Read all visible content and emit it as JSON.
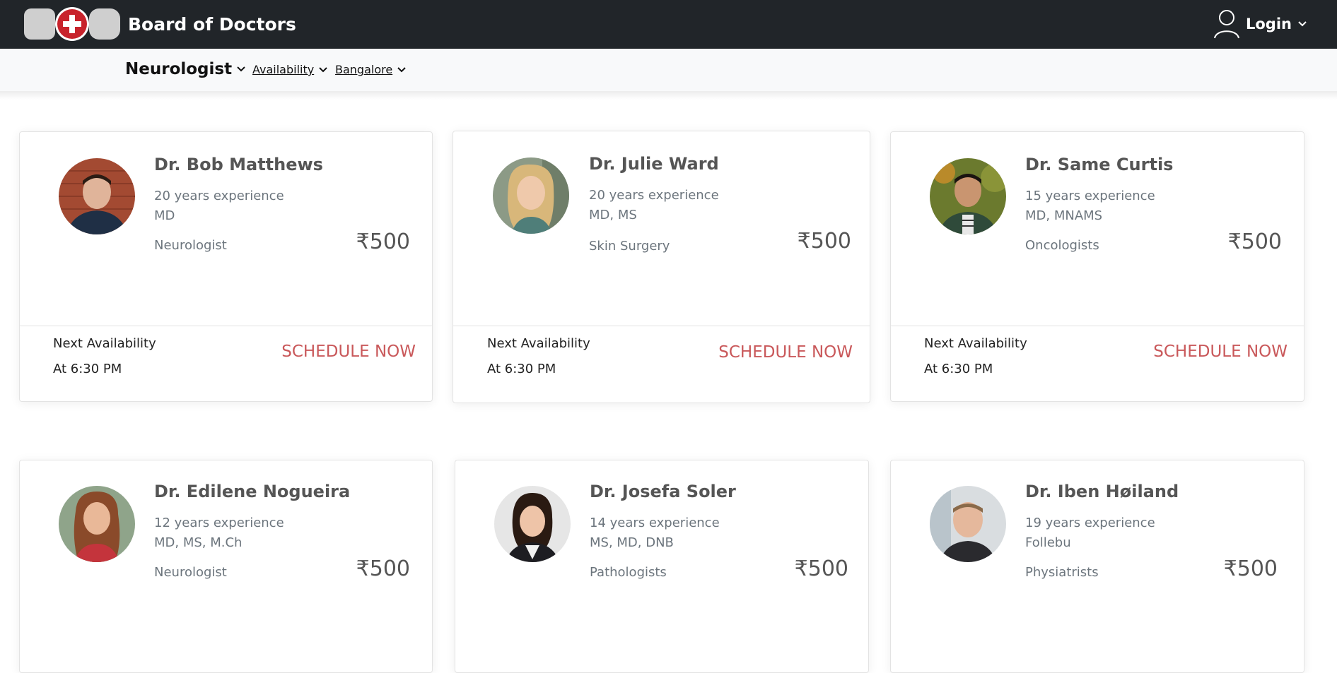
{
  "header": {
    "brand": "Board of Doctors",
    "logo_icon": "bod-cross-logo-icon",
    "login_label": "Login",
    "colors": {
      "bar": "#212529",
      "logo_red": "#c8232c",
      "logo_grey": "#cfcfcf"
    }
  },
  "filters": {
    "specialty": "Neurologist",
    "availability": "Availability",
    "location": "Bangalore"
  },
  "doctors": [
    {
      "name": "Dr. Bob Matthews",
      "experience": "20 years experience",
      "degrees": "MD",
      "specialty": "Neurologist",
      "fee": "₹500",
      "next_label": "Next Availability",
      "next_time": "At 6:30 PM",
      "cta": "SCHEDULE NOW"
    },
    {
      "name": "Dr. Julie Ward",
      "experience": "20 years experience",
      "degrees": "MD, MS",
      "specialty": "Skin Surgery",
      "fee": "₹500",
      "next_label": "Next Availability",
      "next_time": "At 6:30 PM",
      "cta": "SCHEDULE NOW"
    },
    {
      "name": "Dr. Same Curtis",
      "experience": "15 years experience",
      "degrees": "MD, MNAMS",
      "specialty": "Oncologists",
      "fee": "₹500",
      "next_label": "Next Availability",
      "next_time": "At 6:30 PM",
      "cta": "SCHEDULE NOW"
    },
    {
      "name": "Dr. Edilene Nogueira",
      "experience": "12 years experience",
      "degrees": "MD, MS, M.Ch",
      "specialty": "Neurologist",
      "fee": "₹500"
    },
    {
      "name": "Dr. Josefa Soler",
      "experience": "14 years experience",
      "degrees": "MS, MD, DNB",
      "specialty": "Pathologists",
      "fee": "₹500"
    },
    {
      "name": "Dr. Iben Høiland",
      "experience": "19 years experience",
      "degrees": "Follebu",
      "specialty": "Physiatrists",
      "fee": "₹500"
    }
  ],
  "colors": {
    "cta": "#c9585a"
  }
}
